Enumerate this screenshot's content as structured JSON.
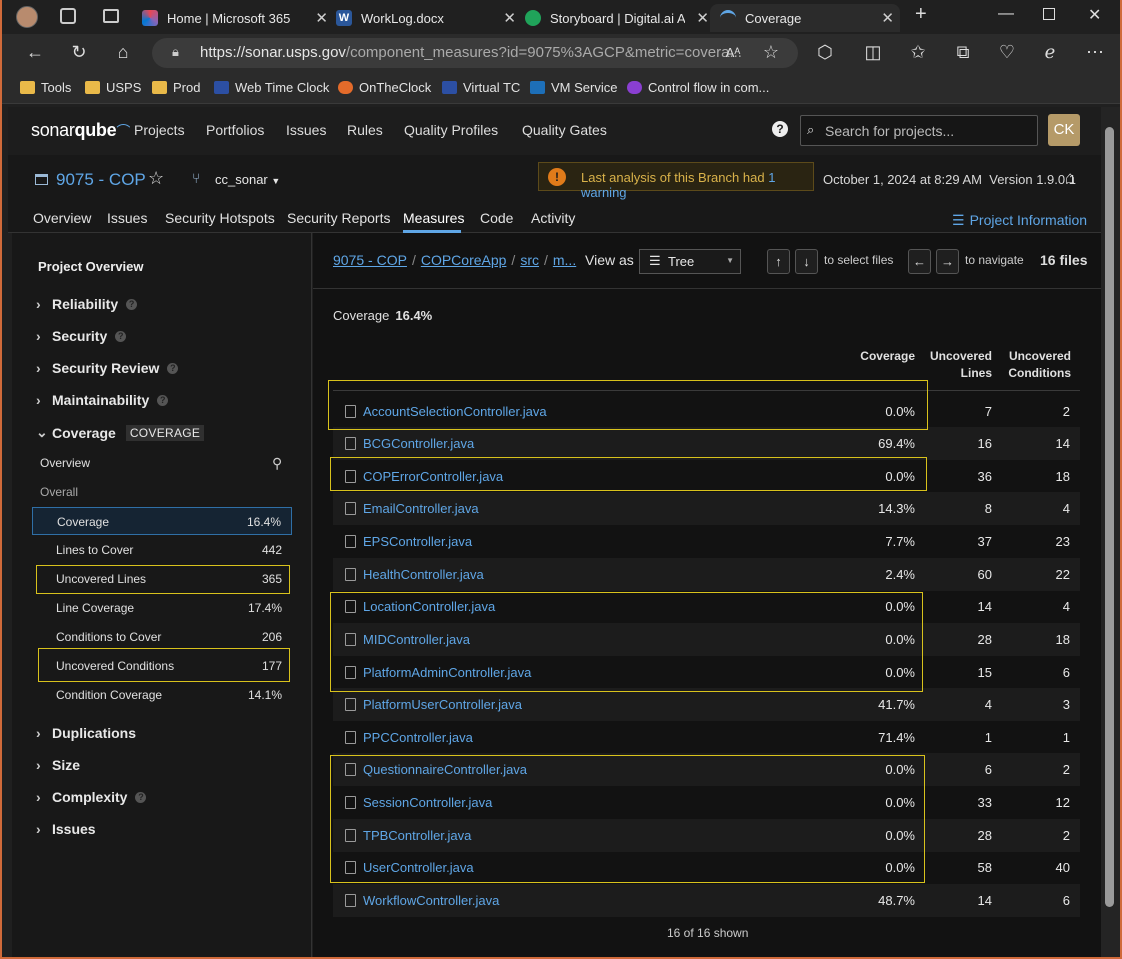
{
  "browser": {
    "tabs": [
      {
        "label": "Home | Microsoft 365",
        "active": false
      },
      {
        "label": "WorkLog.docx",
        "active": false
      },
      {
        "label": "Storyboard | Digital.ai Ag",
        "active": false
      },
      {
        "label": "Coverage",
        "active": true
      }
    ],
    "url_host": "https://sonar.usps.gov",
    "url_path": "/component_measures?id=9075%3AGCP&metric=covera...",
    "bookmarks": [
      "Tools",
      "USPS",
      "Prod",
      "Web Time Clock",
      "OnTheClock",
      "Virtual TC",
      "VM Service",
      "Control flow in com..."
    ]
  },
  "sonar": {
    "logo_a": "sonar",
    "logo_b": "qube",
    "nav": [
      "Projects",
      "Portfolios",
      "Issues",
      "Rules",
      "Quality Profiles",
      "Quality Gates"
    ],
    "search_placeholder": "Search for projects...",
    "avatar": "CK"
  },
  "project": {
    "name": "9075 - COP",
    "branch": "cc_sonar",
    "warning_text": "Last analysis of this Branch had",
    "warning_link": "1 warning",
    "analysis_date": "October 1, 2024 at 8:29 AM",
    "version": "Version 1.9.0.1",
    "tabs": [
      "Overview",
      "Issues",
      "Security Hotspots",
      "Security Reports",
      "Measures",
      "Code",
      "Activity"
    ],
    "active_tab": "Measures",
    "info_link": "Project Information"
  },
  "sidebar": {
    "title": "Project Overview",
    "domains_top": [
      "Reliability",
      "Security",
      "Security Review",
      "Maintainability"
    ],
    "coverage_label": "Coverage",
    "coverage_tag": "COVERAGE",
    "overview_label": "Overview",
    "overall_label": "Overall",
    "metrics": [
      {
        "name": "Coverage",
        "value": "16.4%"
      },
      {
        "name": "Lines to Cover",
        "value": "442"
      },
      {
        "name": "Uncovered Lines",
        "value": "365"
      },
      {
        "name": "Line Coverage",
        "value": "17.4%"
      },
      {
        "name": "Conditions to Cover",
        "value": "206"
      },
      {
        "name": "Uncovered Conditions",
        "value": "177"
      },
      {
        "name": "Condition Coverage",
        "value": "14.1%"
      }
    ],
    "domains_bottom": [
      "Duplications",
      "Size",
      "Complexity",
      "Issues"
    ]
  },
  "main": {
    "breadcrumbs": [
      "9075 - COP",
      "COPCoreApp",
      "src",
      "m..."
    ],
    "view_as_label": "View as",
    "view_mode": "Tree",
    "select_hint": "to select files",
    "navigate_hint": "to navigate",
    "file_count": "16 files",
    "coverage_label": "Coverage",
    "coverage_value": "16.4%",
    "col_coverage": "Coverage",
    "col_uncovered_lines_1": "Uncovered",
    "col_uncovered_lines_2": "Lines",
    "col_uncovered_conditions_1": "Uncovered",
    "col_uncovered_conditions_2": "Conditions",
    "files": [
      {
        "name": "AccountSelectionController.java",
        "coverage": "0.0%",
        "lines": "7",
        "conditions": "2"
      },
      {
        "name": "BCGController.java",
        "coverage": "69.4%",
        "lines": "16",
        "conditions": "14"
      },
      {
        "name": "COPErrorController.java",
        "coverage": "0.0%",
        "lines": "36",
        "conditions": "18"
      },
      {
        "name": "EmailController.java",
        "coverage": "14.3%",
        "lines": "8",
        "conditions": "4"
      },
      {
        "name": "EPSController.java",
        "coverage": "7.7%",
        "lines": "37",
        "conditions": "23"
      },
      {
        "name": "HealthController.java",
        "coverage": "2.4%",
        "lines": "60",
        "conditions": "22"
      },
      {
        "name": "LocationController.java",
        "coverage": "0.0%",
        "lines": "14",
        "conditions": "4"
      },
      {
        "name": "MIDController.java",
        "coverage": "0.0%",
        "lines": "28",
        "conditions": "18"
      },
      {
        "name": "PlatformAdminController.java",
        "coverage": "0.0%",
        "lines": "15",
        "conditions": "6"
      },
      {
        "name": "PlatformUserController.java",
        "coverage": "41.7%",
        "lines": "4",
        "conditions": "3"
      },
      {
        "name": "PPCController.java",
        "coverage": "71.4%",
        "lines": "1",
        "conditions": "1"
      },
      {
        "name": "QuestionnaireController.java",
        "coverage": "0.0%",
        "lines": "6",
        "conditions": "2"
      },
      {
        "name": "SessionController.java",
        "coverage": "0.0%",
        "lines": "33",
        "conditions": "12"
      },
      {
        "name": "TPBController.java",
        "coverage": "0.0%",
        "lines": "28",
        "conditions": "2"
      },
      {
        "name": "UserController.java",
        "coverage": "0.0%",
        "lines": "58",
        "conditions": "40"
      },
      {
        "name": "WorkflowController.java",
        "coverage": "48.7%",
        "lines": "14",
        "conditions": "6"
      }
    ],
    "shown": "16 of 16 shown"
  },
  "colors": {
    "link": "#5fa6e6",
    "highlight": "#d8c21c",
    "warning": "#e07b1a"
  }
}
